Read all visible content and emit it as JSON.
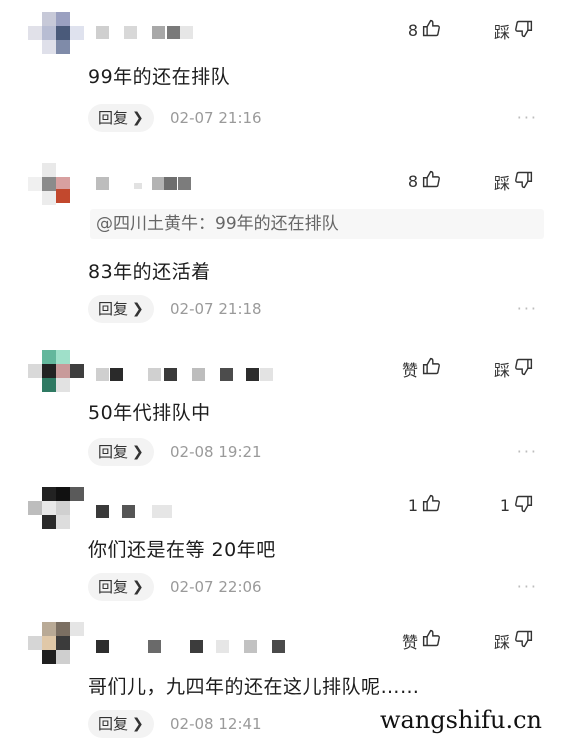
{
  "comments": [
    {
      "text": "99年的还在排队",
      "like": "8",
      "dislike": "踩",
      "reply": "回复",
      "time": "02-07 21:16",
      "more": "···"
    },
    {
      "quote": "@四川土黄牛：99年的还在排队",
      "text": "83年的还活着",
      "like": "8",
      "dislike": "踩",
      "reply": "回复",
      "time": "02-07 21:18",
      "more": "···"
    },
    {
      "text": "50年代排队中",
      "like": "赞",
      "dislike": "踩",
      "reply": "回复",
      "time": "02-08 19:21",
      "more": "···"
    },
    {
      "text": "你们还是在等 20年吧",
      "like": "1",
      "dislike": "1",
      "reply": "回复",
      "time": "02-07 22:06",
      "more": "···"
    },
    {
      "text": "哥们儿，九四年的还在这儿排队呢……",
      "like": "赞",
      "dislike": "踩",
      "reply": "回复",
      "time": "02-08 12:41",
      "more": "···"
    }
  ],
  "icons": {
    "like": "thumbs-up-icon",
    "dislike": "thumbs-down-icon",
    "more": "more-dots-icon",
    "reply_chevron": "chevron-right-icon"
  },
  "watermark": "wangshifu.cn"
}
